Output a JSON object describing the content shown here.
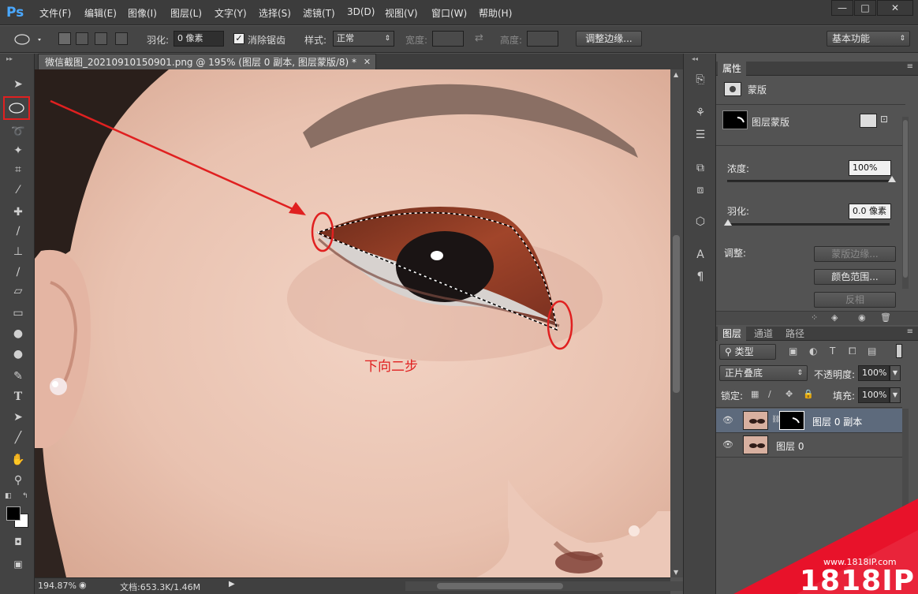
{
  "menubar": {
    "logo": "Ps",
    "items": [
      "文件(F)",
      "编辑(E)",
      "图像(I)",
      "图层(L)",
      "文字(Y)",
      "选择(S)",
      "滤镜(T)",
      "3D(D)",
      "视图(V)",
      "窗口(W)",
      "帮助(H)"
    ],
    "window_buttons": [
      "—",
      "□",
      "✕"
    ]
  },
  "options": {
    "feather_label": "羽化:",
    "feather_value": "0 像素",
    "antialias_label": "消除锯齿",
    "style_label": "样式:",
    "style_value": "正常",
    "width_label": "宽度:",
    "height_label": "高度:",
    "refine_edge": "调整边缘...",
    "workspace": "基本功能"
  },
  "document": {
    "tab_title": "微信截图_20210910150901.png @ 195% (图层 0 副本, 图层蒙版/8) *",
    "annotation": "下向二步",
    "annotation_color": "#e02020"
  },
  "status": {
    "zoom": "194.87%",
    "doc_info": "文档:653.3K/1.46M"
  },
  "properties": {
    "tab": "属性",
    "type_label": "蒙版",
    "mask_label": "图层蒙版",
    "density_label": "浓度:",
    "density_value": "100%",
    "feather_label": "羽化:",
    "feather_value": "0.0 像素",
    "adjust_label": "调整:",
    "btn_mask_edge": "蒙版边缘...",
    "btn_color_range": "颜色范围...",
    "btn_invert": "反相"
  },
  "layers_panel": {
    "tabs": [
      "图层",
      "通道",
      "路径"
    ],
    "filter_kind": "类型",
    "blend_mode": "正片叠底",
    "opacity_label": "不透明度:",
    "opacity_value": "100%",
    "lock_label": "锁定:",
    "fill_label": "填充:",
    "fill_value": "100%",
    "layers": [
      {
        "name": "图层 0 副本",
        "selected": true
      },
      {
        "name": "图层 0",
        "selected": false
      }
    ]
  },
  "watermark": {
    "url": "www.1818IP.com",
    "brand": "1818IP"
  }
}
